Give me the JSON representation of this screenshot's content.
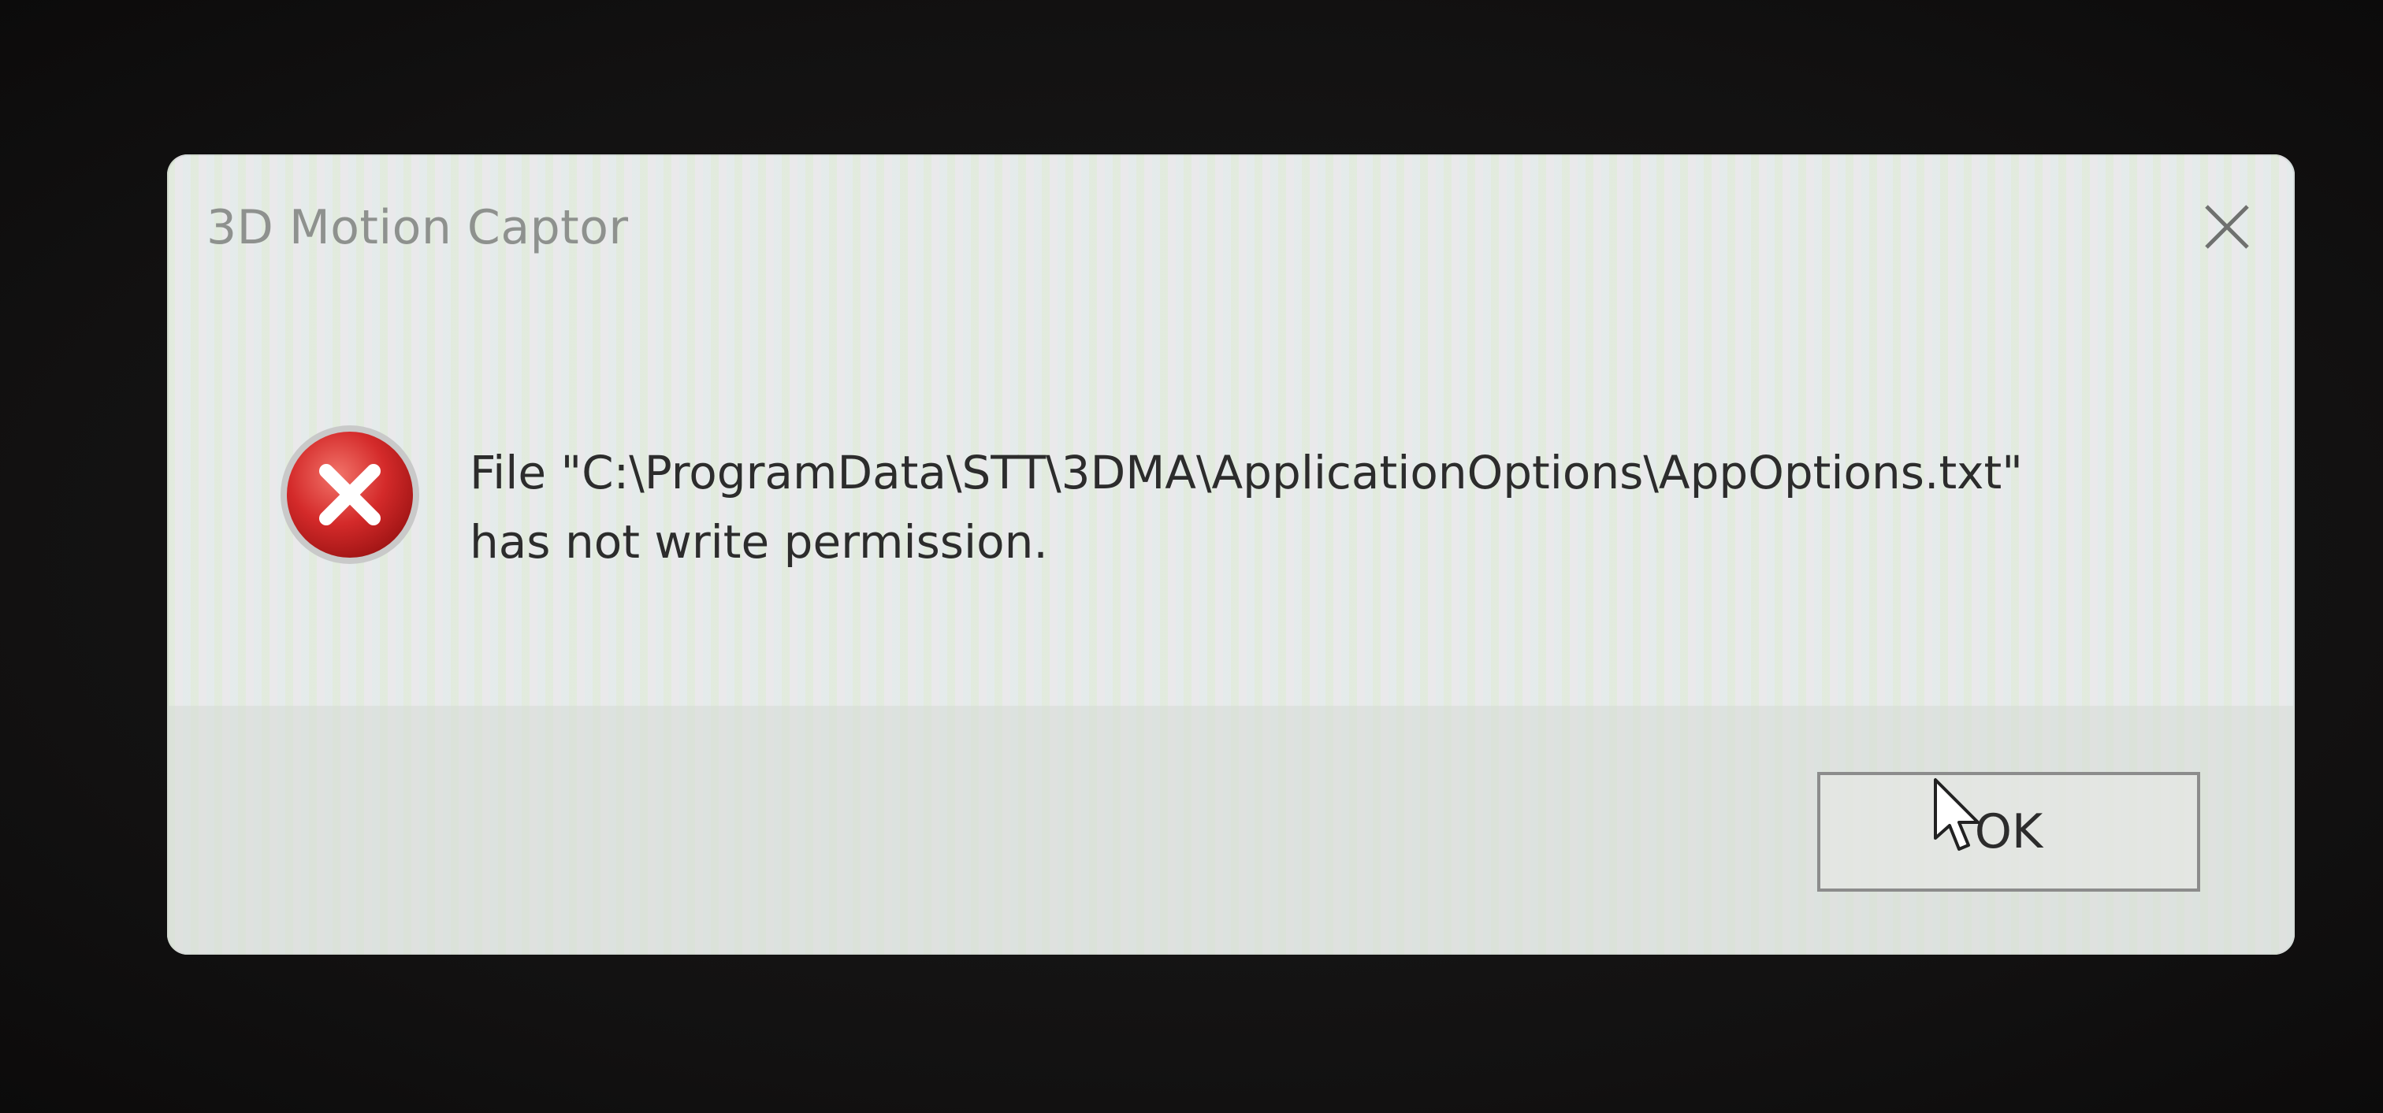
{
  "dialog": {
    "title": "3D Motion Captor",
    "message_line1": "File \"C:\\ProgramData\\STT\\3DMA\\ApplicationOptions\\AppOptions.txt\"",
    "message_line2": "has not write permission.",
    "ok_label": "OK",
    "close_icon": "close-icon",
    "status_icon": "error-icon"
  },
  "colors": {
    "dialog_background": "#ecefeb",
    "error_red": "#d42a2a",
    "text": "#2c2c2c",
    "title_text": "#8e918e"
  }
}
